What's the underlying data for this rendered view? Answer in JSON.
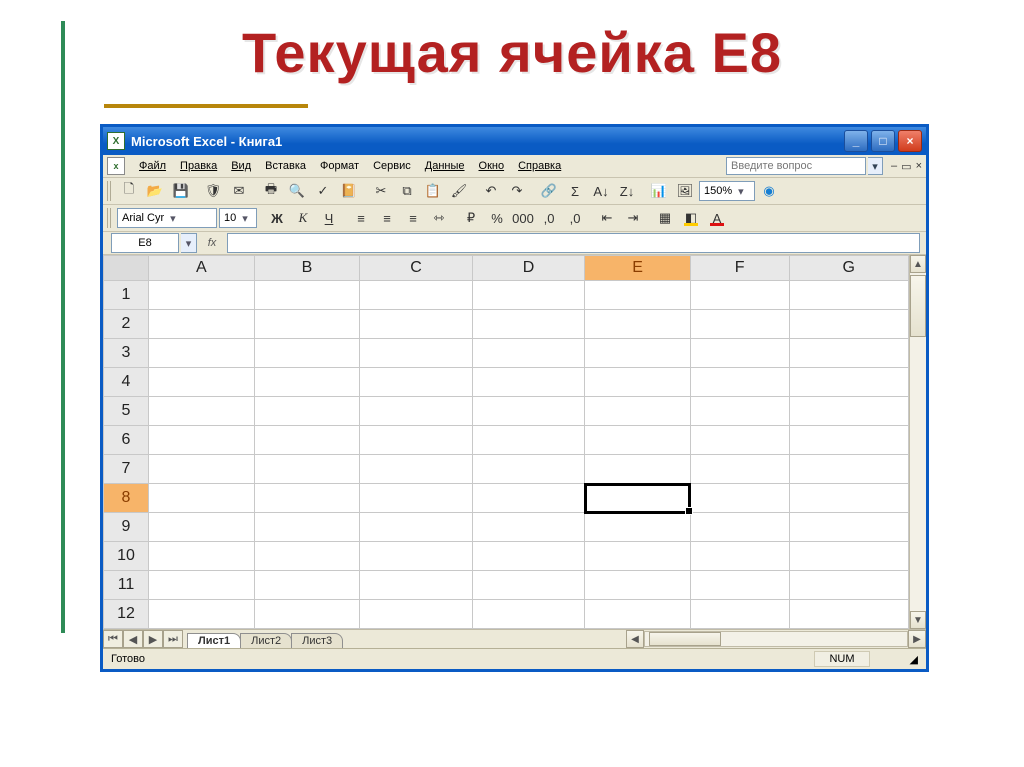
{
  "slide": {
    "title": "Текущая ячейка E8"
  },
  "excel": {
    "title": "Microsoft Excel - Книга1",
    "app_icon_glyph": "X",
    "menus": {
      "file": "Файл",
      "edit": "Правка",
      "view": "Вид",
      "insert": "Вставка",
      "format": "Формат",
      "tools": "Сервис",
      "data": "Данные",
      "window": "Окно",
      "help": "Справка"
    },
    "help_placeholder": "Введите вопрос",
    "zoom": "150%",
    "font": {
      "name": "Arial Cyr",
      "size": "10"
    },
    "fmt_labels": {
      "bold": "Ж",
      "italic": "К",
      "underline": "Ч"
    },
    "name_box": "E8",
    "fx": "fx",
    "columns": [
      "A",
      "B",
      "C",
      "D",
      "E",
      "F",
      "G"
    ],
    "rows": [
      "1",
      "2",
      "3",
      "4",
      "5",
      "6",
      "7",
      "8",
      "9",
      "10",
      "11",
      "12"
    ],
    "selected": {
      "col": "E",
      "row": "8"
    },
    "sheets": {
      "active": "Лист1",
      "others": [
        "Лист2",
        "Лист3"
      ]
    },
    "status": {
      "left": "Готово",
      "num": "NUM"
    }
  }
}
